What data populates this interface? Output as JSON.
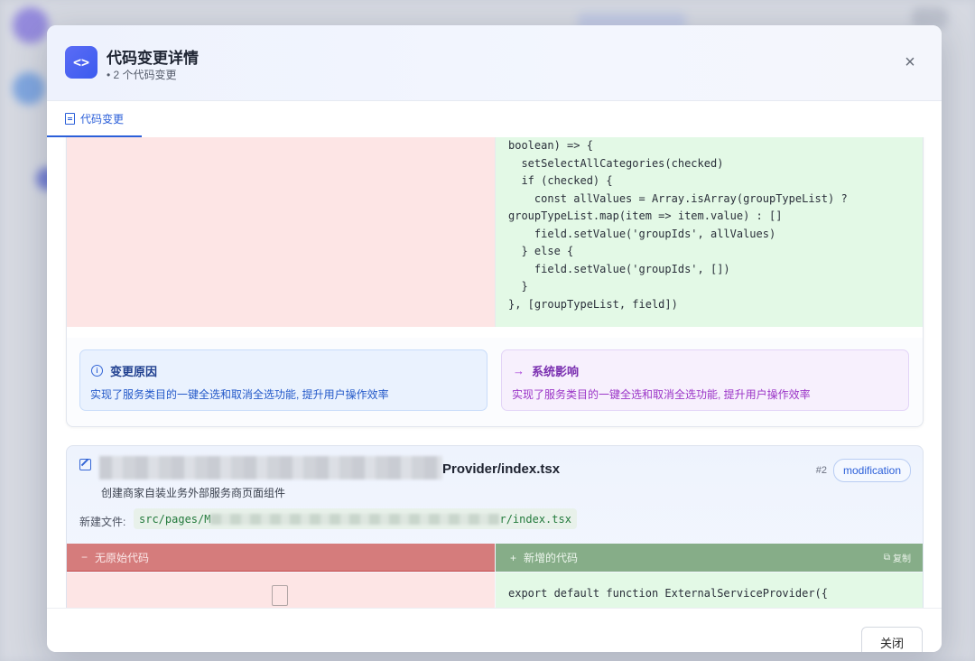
{
  "modal": {
    "icon_glyph": "<>",
    "title": "代码变更详情",
    "subtitle": "• 2 个代码变更",
    "close_glyph": "×",
    "tab_label": "代码变更",
    "footer_close": "关闭"
  },
  "change1": {
    "code_lines": [
      "boolean) => {",
      "  setSelectAllCategories(checked)",
      "  if (checked) {",
      "    const allValues = Array.isArray(groupTypeList) ?",
      "groupTypeList.map(item => item.value) : []",
      "    field.setValue('groupIds', allValues)",
      "  } else {",
      "    field.setValue('groupIds', [])",
      "  }",
      "}, [groupTypeList, field])"
    ],
    "reason_title": "变更原因",
    "reason_text": "实现了服务类目的一键全选和取消全选功能, 提升用户操作效率",
    "impact_title": "系统影响",
    "impact_text": "实现了服务类目的一键全选和取消全选功能, 提升用户操作效率"
  },
  "change2": {
    "file_name_visible": "Provider/index.tsx",
    "description": "创建商家自装业务外部服务商页面组件",
    "number": "#2",
    "type_badge": "modification",
    "new_file_label": "新建文件:",
    "path_prefix": "src/pages/M",
    "path_suffix": "r/index.tsx",
    "left_header": "无原始代码",
    "right_header": "新增的代码",
    "copy_label": "复制",
    "code_line_1": "export default function ExternalServiceProvider({"
  },
  "colors": {
    "accent": "#2b5fd9",
    "removed_bg": "#fde5e5",
    "added_bg": "#e3f9e6",
    "removed_header": "#d57c7c",
    "added_header": "#86ad88"
  }
}
